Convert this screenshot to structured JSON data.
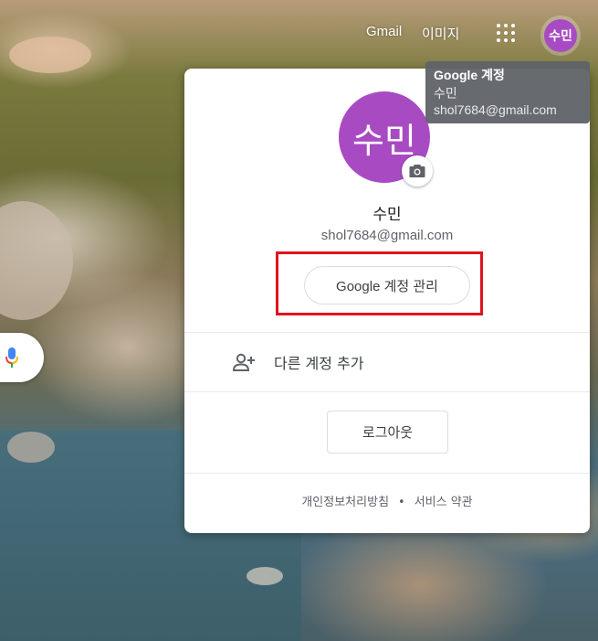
{
  "topbar": {
    "gmail_label": "Gmail",
    "images_label": "이미지",
    "apps_icon": "apps-grid-icon",
    "avatar_initials": "수민"
  },
  "tooltip": {
    "title": "Google 계정",
    "name": "수민",
    "email": "shol7684@gmail.com"
  },
  "account_panel": {
    "avatar_initials": "수민",
    "camera_icon": "camera-icon",
    "name": "수민",
    "email": "shol7684@gmail.com",
    "manage_button_label": "Google 계정 관리",
    "add_account_label": "다른 계정 추가",
    "add_account_icon": "person-add-icon",
    "logout_label": "로그아웃",
    "footer": {
      "privacy_label": "개인정보처리방침",
      "separator": "•",
      "terms_label": "서비스 약관"
    }
  },
  "colors": {
    "avatar_bg": "#a84bc3",
    "highlight_border": "#e0141e",
    "mic_blue": "#4285f4",
    "mic_red": "#ea4335",
    "mic_yellow": "#fbbc04",
    "mic_green": "#34a853"
  },
  "search": {
    "mic_icon": "microphone-icon"
  }
}
